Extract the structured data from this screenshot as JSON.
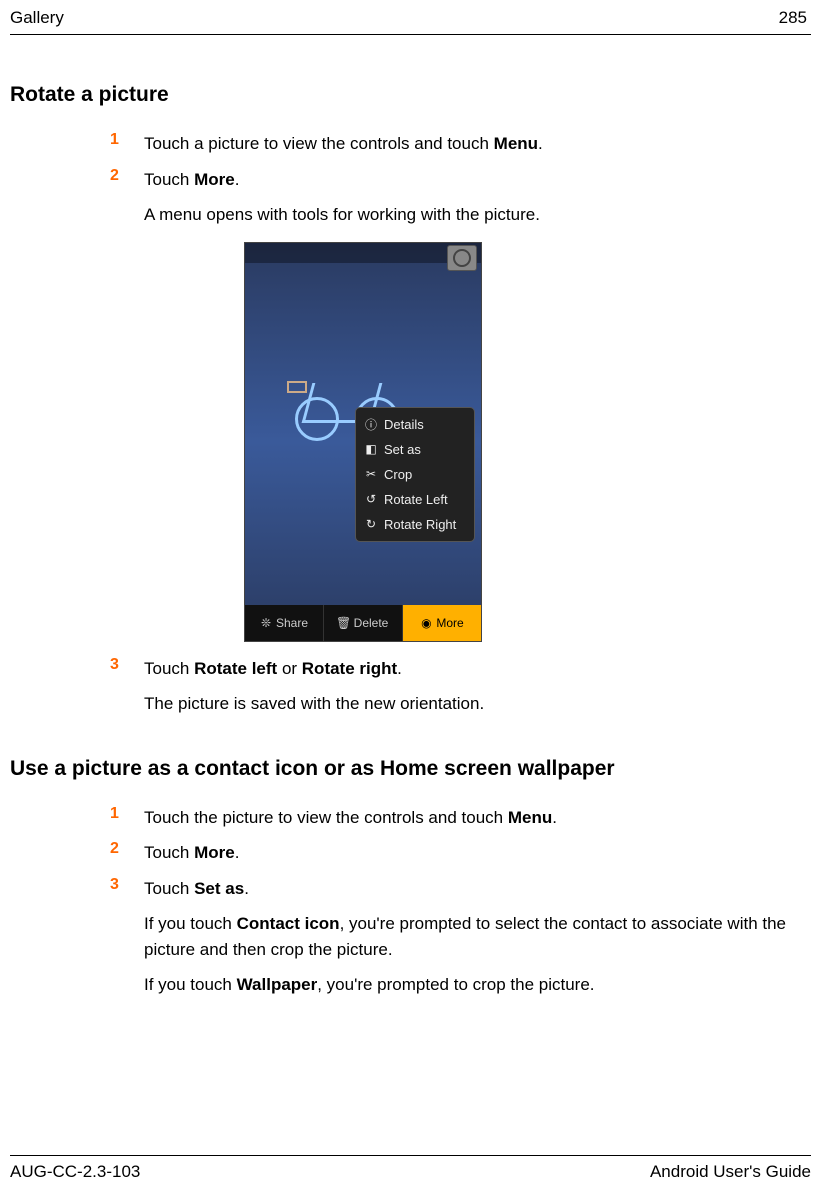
{
  "header": {
    "left": "Gallery",
    "right": "285"
  },
  "section1": {
    "heading": "Rotate a picture",
    "steps": [
      {
        "num": "1",
        "pre": "Touch a picture to view the controls and touch ",
        "bold": "Menu",
        "post": "."
      },
      {
        "num": "2",
        "pre": "Touch ",
        "bold": "More",
        "post": "."
      }
    ],
    "note1": "A menu opens with tools for working with the picture.",
    "step3": {
      "num": "3",
      "pre": "Touch ",
      "bold1": "Rotate left",
      "mid": " or ",
      "bold2": "Rotate right",
      "post": "."
    },
    "note2": "The picture is saved with the new orientation."
  },
  "screenshot": {
    "popup_items": [
      "Details",
      "Set as",
      "Crop",
      "Rotate Left",
      "Rotate Right"
    ],
    "bottom_buttons": [
      "Share",
      "Delete",
      "More"
    ]
  },
  "section2": {
    "heading": "Use a picture as a contact icon or as Home screen wallpaper",
    "steps": [
      {
        "num": "1",
        "pre": "Touch the picture to view the controls and touch ",
        "bold": "Menu",
        "post": "."
      },
      {
        "num": "2",
        "pre": "Touch ",
        "bold": "More",
        "post": "."
      },
      {
        "num": "3",
        "pre": "Touch ",
        "bold": "Set as",
        "post": "."
      }
    ],
    "para1": {
      "pre": "If you touch ",
      "bold": "Contact icon",
      "post": ", you're prompted to select the contact to associate with the picture and then crop the picture."
    },
    "para2": {
      "pre": "If you touch ",
      "bold": "Wallpaper",
      "post": ", you're prompted to crop the picture."
    }
  },
  "footer": {
    "left": "AUG-CC-2.3-103",
    "right": "Android User's Guide"
  }
}
